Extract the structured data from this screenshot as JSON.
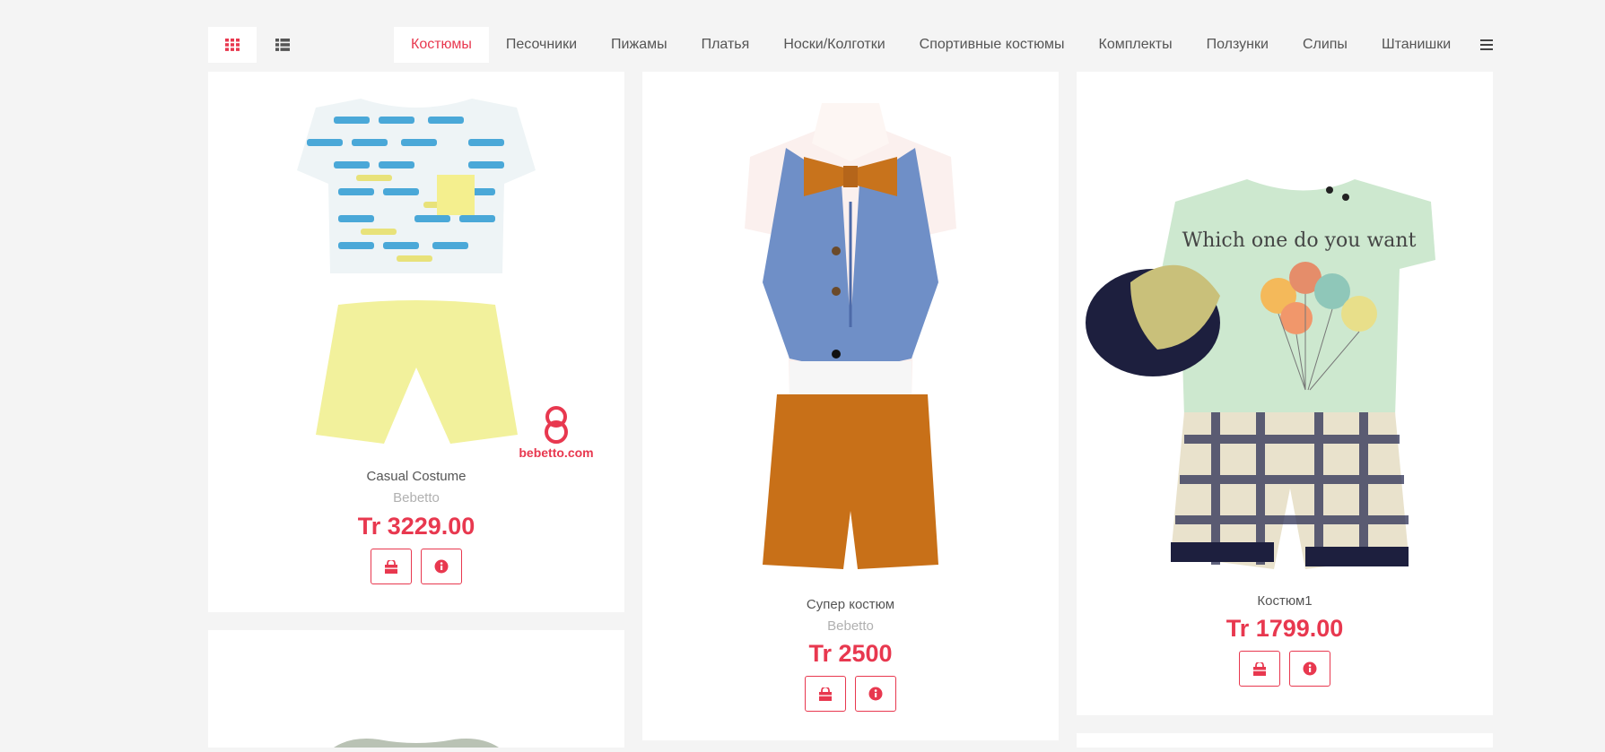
{
  "colors": {
    "accent": "#e8384f",
    "background": "#f4f4f4",
    "card": "#ffffff"
  },
  "toolbar": {
    "grid_view_icon": "grid-icon",
    "list_view_icon": "list-icon",
    "menu_icon": "hamburger-icon"
  },
  "categories": [
    {
      "label": "Костюмы",
      "active": true
    },
    {
      "label": "Песочники"
    },
    {
      "label": "Пижамы"
    },
    {
      "label": "Платья"
    },
    {
      "label": "Носки/Колготки"
    },
    {
      "label": "Спортивные костюмы"
    },
    {
      "label": "Комплекты"
    },
    {
      "label": "Ползунки"
    },
    {
      "label": "Слипы"
    },
    {
      "label": "Штанишки"
    }
  ],
  "products": [
    {
      "name": "Casual Costume",
      "brand": "Bebetto",
      "price": "Tr 3229.00",
      "watermark": "bebetto.com",
      "cart_icon": "shopping-bag-icon",
      "info_icon": "info-icon"
    },
    {
      "name": "Супер костюм",
      "brand": "Bebetto",
      "price": "Tr 2500",
      "cart_icon": "shopping-bag-icon",
      "info_icon": "info-icon"
    },
    {
      "name": "Костюм1",
      "brand": "",
      "price": "Tr 1799.00",
      "tshirt_text": "Which one do you want",
      "cart_icon": "shopping-bag-icon",
      "info_icon": "info-icon"
    }
  ]
}
